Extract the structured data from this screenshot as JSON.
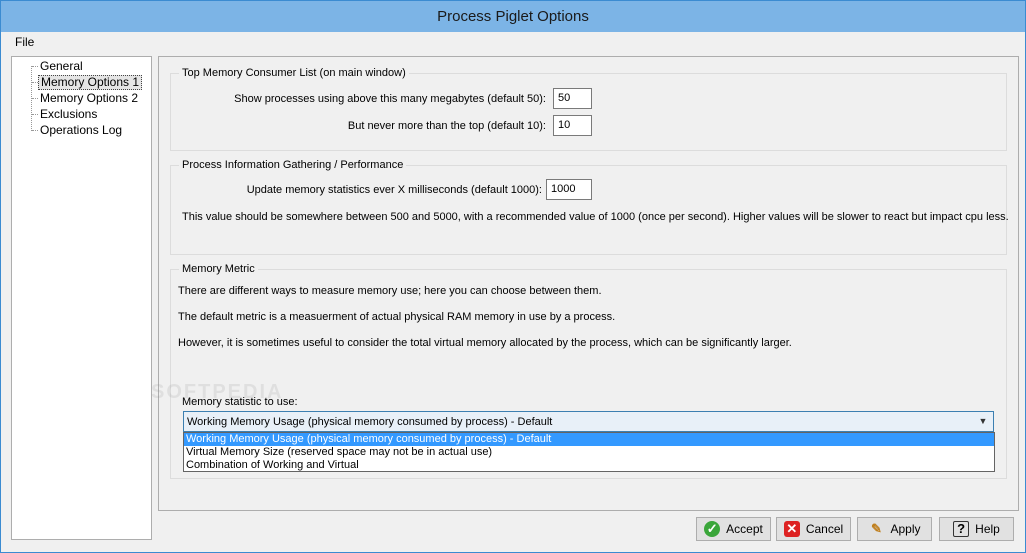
{
  "window": {
    "title": "Process Piglet Options"
  },
  "menu": {
    "file": "File"
  },
  "tree": {
    "items": [
      {
        "label": "General",
        "selected": false
      },
      {
        "label": "Memory Options 1",
        "selected": true
      },
      {
        "label": "Memory Options 2",
        "selected": false
      },
      {
        "label": "Exclusions",
        "selected": false
      },
      {
        "label": "Operations Log",
        "selected": false
      }
    ]
  },
  "top_memory": {
    "title": "Top Memory Consumer List (on main window)",
    "threshold_label": "Show processes using above this many megabytes (default 50):",
    "threshold_value": "50",
    "max_label": "But never more than the top (default 10):",
    "max_value": "10"
  },
  "gathering": {
    "title": "Process Information Gathering / Performance",
    "interval_label": "Update memory statistics ever X milliseconds (default 1000):",
    "interval_value": "1000",
    "note": "This value should be somewhere between 500 and 5000, with a recommended value of 1000 (once per second).  Higher values will be slower to react but impact cpu less."
  },
  "metric": {
    "title": "Memory Metric",
    "line1": "There are different ways to measure memory use; here you can choose between them.",
    "line2": "The default metric is a measuerment of actual physical RAM memory in use by a process.",
    "line3": "However, it is sometimes useful to consider the total virtual memory allocated by the process, which can be significantly larger.",
    "statistic_label": "Memory statistic to use:",
    "selected": "Working Memory Usage (physical memory consumed by process) - Default",
    "options": [
      "Working Memory Usage (physical memory consumed by process) - Default",
      "Virtual Memory Size (reserved space may not be in actual use)",
      "Combination of Working and Virtual"
    ]
  },
  "buttons": {
    "accept": "Accept",
    "cancel": "Cancel",
    "apply": "Apply",
    "help": "Help"
  },
  "watermark": "SOFTPEDIA"
}
